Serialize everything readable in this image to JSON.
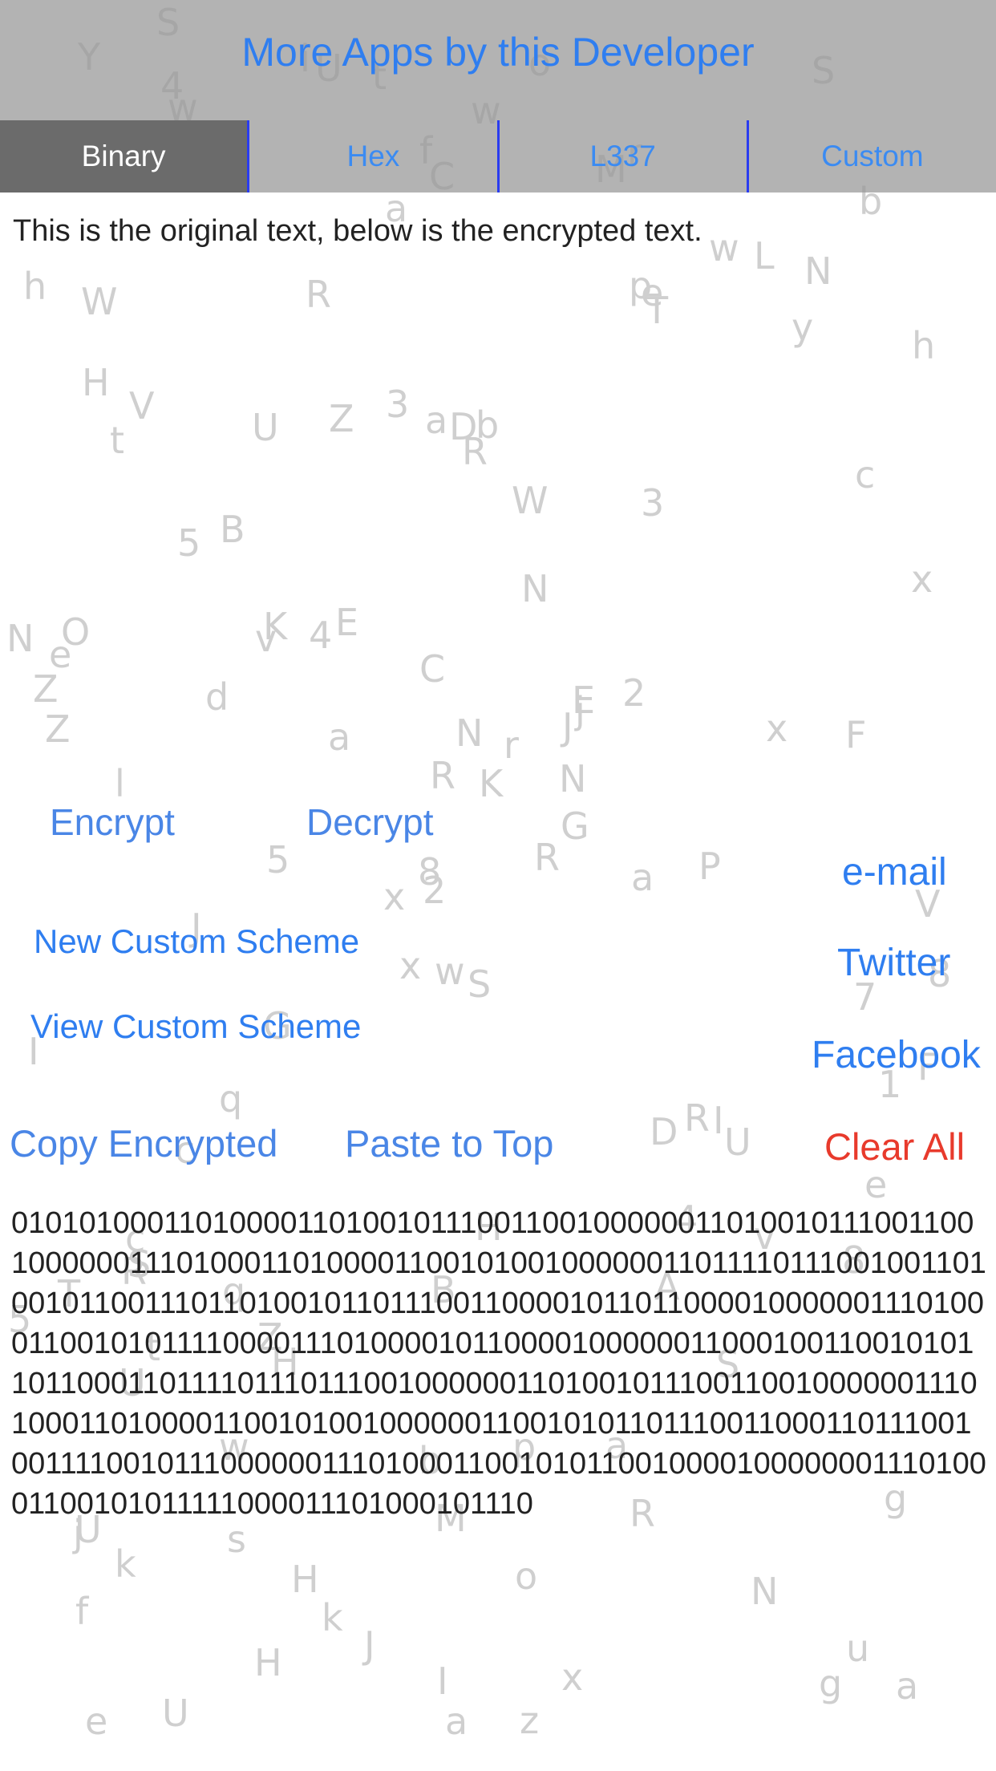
{
  "header": {
    "more_apps_label": "More Apps by this Developer",
    "tabs": [
      {
        "label": "Binary",
        "selected": true
      },
      {
        "label": "Hex",
        "selected": false
      },
      {
        "label": "L337",
        "selected": false
      },
      {
        "label": "Custom",
        "selected": false
      }
    ]
  },
  "original_text": "This is the original text, below is the encrypted text.",
  "actions": {
    "encrypt": "Encrypt",
    "decrypt": "Decrypt",
    "new_custom_scheme": "New Custom Scheme",
    "view_custom_scheme": "View Custom Scheme",
    "email": "e-mail",
    "twitter": "Twitter",
    "facebook": "Facebook",
    "copy_encrypted": "Copy Encrypted",
    "paste_to_top": "Paste to Top",
    "clear_all": "Clear All"
  },
  "encrypted_text": "0101010001101000011010010111001100100000011010010111001100100000011101000110100001100101001000000110111101110010011010010110011101101001011011100110000101101100001000000111010001100101011110000111010000101100001000000110001001100101011011000110111101110111001000000110100101110011001000000111010001101000011001010010000001100101011011100110001101110010011110010111000000111010001100101011001000010000000111010001100101011111000011101000101110",
  "background_letters": [
    "S",
    "t",
    "2",
    "U",
    "J",
    "H",
    "r",
    "b",
    "e",
    "R",
    "w",
    "a",
    "l",
    "h",
    "x",
    "3",
    "U",
    "a",
    "N",
    "t",
    "E",
    "f",
    "s",
    "D",
    "j",
    "U",
    "V",
    "C",
    "Z",
    "D",
    "x",
    "8",
    "b",
    "R",
    "U",
    "w",
    "Z",
    "g",
    "g",
    "I",
    "o",
    "4",
    "d",
    "A",
    "H",
    "N",
    "N",
    "e",
    "M",
    "G",
    "U",
    "c",
    "h",
    "4",
    "R",
    "w",
    "4",
    "Y",
    "p",
    "N",
    "w",
    "5",
    "O",
    "B",
    "L",
    "S",
    "M",
    "a",
    "N",
    "5",
    "B",
    "k",
    "R",
    "v",
    "j",
    "D",
    "5",
    "I",
    "C",
    "o",
    "r",
    "k",
    "a",
    "e",
    "I",
    "F",
    "H",
    "N",
    "z",
    "a",
    "f",
    "8",
    "2",
    "S",
    "K",
    "8",
    "e",
    "a",
    "p",
    "T",
    "J",
    "i",
    "V",
    "Z",
    "c",
    "q",
    "H",
    "E",
    "y",
    "a",
    "7",
    "W",
    "R",
    "x",
    "U",
    "T",
    "w",
    "b",
    "3",
    "t",
    "R",
    "S",
    "W",
    "Z",
    "P",
    "q",
    "u",
    "J",
    "x",
    "H",
    "S",
    "x",
    "K",
    "R",
    "1",
    "v",
    "G",
    "c",
    "F"
  ]
}
